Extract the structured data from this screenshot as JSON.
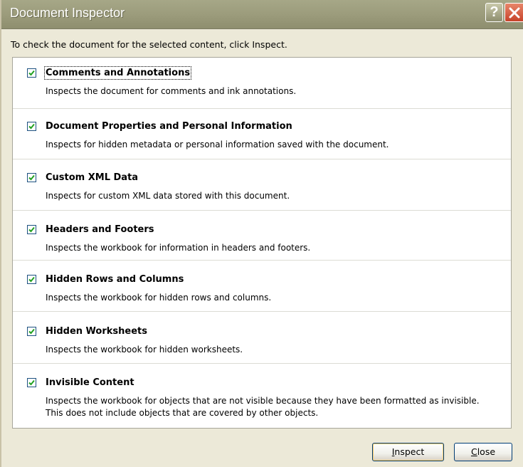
{
  "window": {
    "title": "Document Inspector",
    "help_icon": "help-icon",
    "close_icon": "close-icon"
  },
  "instruction": "To check the document for the selected content, click Inspect.",
  "items": [
    {
      "title": "Comments and Annotations",
      "description": "Inspects the document for comments and ink annotations.",
      "checked": true
    },
    {
      "title": "Document Properties and Personal Information",
      "description": "Inspects for hidden metadata or personal information saved with the document.",
      "checked": true
    },
    {
      "title": "Custom XML Data",
      "description": "Inspects for custom XML data stored with this document.",
      "checked": true
    },
    {
      "title": "Headers and Footers",
      "description": "Inspects the workbook for information in headers and footers.",
      "checked": true
    },
    {
      "title": "Hidden Rows and Columns",
      "description": "Inspects the workbook for hidden rows and columns.",
      "checked": true
    },
    {
      "title": "Hidden Worksheets",
      "description": "Inspects the workbook for hidden worksheets.",
      "checked": true
    },
    {
      "title": "Invisible Content",
      "description": "Inspects the workbook for objects that are not visible because they have been formatted as invisible. This does not include objects that are covered by other objects.",
      "checked": true
    }
  ],
  "buttons": {
    "inspect_first": "I",
    "inspect_rest": "nspect",
    "close_first": "C",
    "close_rest": "lose"
  },
  "colors": {
    "titlebar": "#9c9c7c",
    "checkbox_border": "#1d5180",
    "checkmark": "#21a121"
  }
}
